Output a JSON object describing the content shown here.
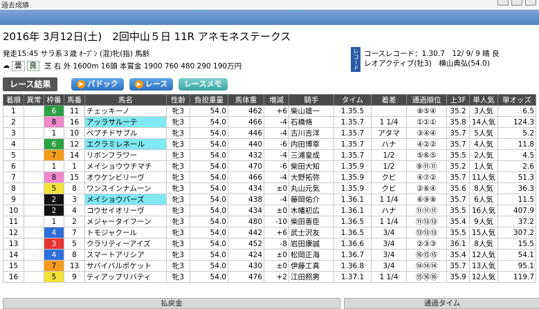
{
  "window": {
    "title": "過去成績"
  },
  "race": {
    "header": "2016年 3月12日(土)　2回中山５日 11R アネモネステークス"
  },
  "info": {
    "line1": "発走15:45 サラ系３歳 ｵｰﾌﾟﾝ (混)牝(指) 馬齢",
    "weather": "曇",
    "going": "良",
    "line2": "芝 右 外 1600m 16頭 本賞金 1900 760 480 290 190万円",
    "record_tag": "レコード",
    "course_record": "コースレコード：1.30.7　12/ 9/ 9 晴 良",
    "record_holder": "レオアクティブ(牡3)　横山典弘(54.0)"
  },
  "toolbar": {
    "title": "レース結果",
    "paddock": "パドック",
    "race": "レース",
    "memo": "レースメモ"
  },
  "table": {
    "headers": [
      "着順",
      "異常",
      "枠番",
      "馬番",
      "馬名",
      "性齢",
      "負担重量",
      "馬体重",
      "増減",
      "騎手",
      "タイム",
      "着差",
      "通過順位",
      "上3F",
      "単人気",
      "単オッズ"
    ],
    "rows": [
      [
        "1",
        "",
        "6",
        "11",
        "チェッキーノ",
        "牝3",
        "54.0",
        "462",
        "+6",
        "柴山雄一",
        "1.35.5",
        "",
        "⑧⑤④",
        "35.2",
        "3人気",
        "6.5"
      ],
      [
        "2",
        "",
        "8",
        "16",
        "アッラサルーテ",
        "牝3",
        "54.0",
        "466",
        "-4",
        "石橋脩",
        "1.35.7",
        "1 1/4",
        "①①①",
        "35.8",
        "14人気",
        "124.3"
      ],
      [
        "3",
        "",
        "1",
        "10",
        "ペプチドサプル",
        "牝3",
        "54.0",
        "446",
        "-4",
        "古川吉洋",
        "1.35.7",
        "アタマ",
        "③④④",
        "35.7",
        "5人気",
        "5.2"
      ],
      [
        "4",
        "",
        "6",
        "12",
        "エクラミレネール",
        "牝3",
        "54.0",
        "440",
        "-6",
        "内田博幸",
        "1.35.7",
        "ハナ",
        "④②②",
        "35.7",
        "4人気",
        "11.8"
      ],
      [
        "5",
        "",
        "7",
        "14",
        "リボンフラワー",
        "牝3",
        "54.0",
        "432",
        "-4",
        "三浦皇成",
        "1.35.7",
        "1/2",
        "⑤⑥⑤",
        "35.5",
        "2人気",
        "4.5"
      ],
      [
        "6",
        "",
        "1",
        "1",
        "メイショウウチマチ",
        "牝3",
        "54.0",
        "470",
        "-6",
        "柴田大知",
        "1.35.9",
        "1/2",
        "⑨⑪⑪",
        "35.2",
        "1人気",
        "2.6"
      ],
      [
        "7",
        "",
        "8",
        "15",
        "オウケンビリーヴ",
        "牝3",
        "54.0",
        "466",
        "-4",
        "大野拓弥",
        "1.35.9",
        "クビ",
        "④⑦②",
        "35.7",
        "11人気",
        "51.3"
      ],
      [
        "8",
        "",
        "5",
        "8",
        "ワンスインナムーン",
        "牝3",
        "54.0",
        "434",
        "±0",
        "丸山元気",
        "1.35.9",
        "クビ",
        "②⑥④",
        "35.6",
        "8人気",
        "36.3"
      ],
      [
        "9",
        "",
        "2",
        "3",
        "メイショウバーズ",
        "牝3",
        "54.0",
        "438",
        "-4",
        "藤岡佑介",
        "1.36.1",
        "1 1/4",
        "⑥⑨⑧",
        "35.7",
        "6人気",
        "11.5"
      ],
      [
        "10",
        "",
        "2",
        "4",
        "コウセイオリーヴ",
        "牝3",
        "54.0",
        "434",
        "±0",
        "木幡初広",
        "1.36.1",
        "ハナ",
        "⑪⑪⑪",
        "35.5",
        "16人気",
        "407.9"
      ],
      [
        "11",
        "",
        "1",
        "2",
        "メジャータイフーン",
        "牝3",
        "54.0",
        "480",
        "-10",
        "柴田善臣",
        "1.36.5",
        "1 1/4",
        "⑪⑬⑬",
        "35.4",
        "9人気",
        "37.2"
      ],
      [
        "12",
        "",
        "4",
        "7",
        "トモジャクール",
        "牝3",
        "54.0",
        "442",
        "+6",
        "武士沢友",
        "1.36.5",
        "3/4",
        "⑬⑬⑬",
        "35.5",
        "15人気",
        "307.2"
      ],
      [
        "13",
        "",
        "3",
        "5",
        "クラリティーアイズ",
        "牝3",
        "54.0",
        "452",
        "-8",
        "岩田康誠",
        "1.36.6",
        "3/4",
        "②③③",
        "36.1",
        "8人気",
        "15.5"
      ],
      [
        "14",
        "",
        "4",
        "8",
        "スマートアリシア",
        "牝3",
        "54.0",
        "424",
        "±0",
        "松岡正海",
        "1.36.7",
        "3/4",
        "⑯⑮⑮",
        "35.4",
        "12人気",
        "54.1"
      ],
      [
        "15",
        "",
        "7",
        "13",
        "サバイバルポケット",
        "牝3",
        "54.0",
        "430",
        "±0",
        "伊藤工真",
        "1.36.8",
        "3/4",
        "⑭⑭⑭",
        "35.7",
        "13人気",
        "95.1"
      ],
      [
        "16",
        "",
        "5",
        "9",
        "ティアップリバティ",
        "牝3",
        "54.0",
        "476",
        "+2",
        "江田照男",
        "1.37.1",
        "1 1/4",
        "⑮⑯⑯",
        "35.9",
        "12人気",
        "119.7"
      ]
    ]
  },
  "footer": {
    "payout": "払戻金",
    "passing_time": "通過タイム"
  },
  "colors": {
    "waku1": "#ffffff",
    "waku2": "#111111",
    "waku3": "#e63333",
    "waku4": "#2f6fd8",
    "waku5": "#f2e23a",
    "waku6": "#2ea043",
    "waku7": "#f39c1a",
    "waku8": "#ee88cc",
    "highlight": "#7fe8f2"
  }
}
